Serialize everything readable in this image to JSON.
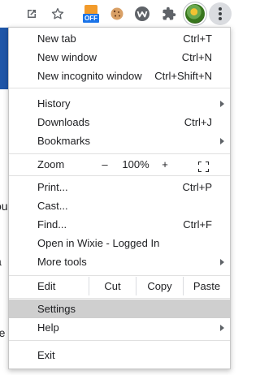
{
  "toolbar": {
    "icons": [
      "open-in-new-window-icon",
      "star-icon",
      "off-extension-icon",
      "cookie-icon",
      "wixie-w-icon",
      "puzzle-extensions-icon",
      "avatar",
      "more-menu-icon"
    ],
    "ext_badge": "OFF"
  },
  "page_fragments": [
    "ou",
    "a",
    "re"
  ],
  "menu": {
    "group1": [
      {
        "label": "New tab",
        "shortcut": "Ctrl+T"
      },
      {
        "label": "New window",
        "shortcut": "Ctrl+N"
      },
      {
        "label": "New incognito window",
        "shortcut": "Ctrl+Shift+N"
      }
    ],
    "group2": [
      {
        "label": "History",
        "submenu": true
      },
      {
        "label": "Downloads",
        "shortcut": "Ctrl+J"
      },
      {
        "label": "Bookmarks",
        "submenu": true
      }
    ],
    "zoom": {
      "label": "Zoom",
      "minus": "–",
      "level": "100%",
      "plus": "+"
    },
    "group3": [
      {
        "label": "Print...",
        "shortcut": "Ctrl+P"
      },
      {
        "label": "Cast..."
      },
      {
        "label": "Find...",
        "shortcut": "Ctrl+F"
      },
      {
        "label": "Open in Wixie - Logged In"
      },
      {
        "label": "More tools",
        "submenu": true
      }
    ],
    "edit": {
      "label": "Edit",
      "cut": "Cut",
      "copy": "Copy",
      "paste": "Paste"
    },
    "group4": [
      {
        "label": "Settings",
        "highlighted": true
      },
      {
        "label": "Help",
        "submenu": true
      }
    ],
    "exit": {
      "label": "Exit"
    }
  },
  "colors": {
    "highlight": "#cfcfcf",
    "page_header_blue": "#1f56a8",
    "ext_orange": "#f29b2b",
    "ext_badge_blue": "#1a73e8"
  }
}
